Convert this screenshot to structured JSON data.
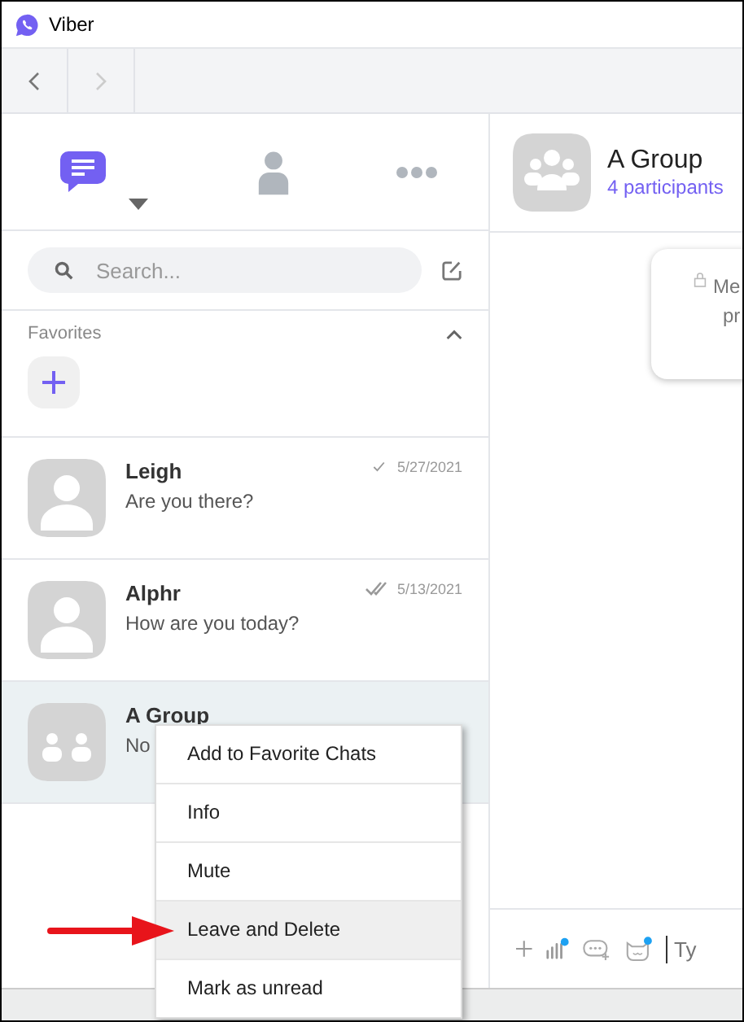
{
  "window": {
    "title": "Viber"
  },
  "tabs": [
    {
      "kind": "chats",
      "selected": true
    },
    {
      "kind": "contacts",
      "selected": false
    },
    {
      "kind": "more",
      "selected": false
    }
  ],
  "search": {
    "placeholder": "Search..."
  },
  "favorites": {
    "label": "Favorites",
    "expanded": true
  },
  "chats": [
    {
      "name": "Leigh",
      "preview": "Are you there?",
      "date": "5/27/2021",
      "read": false,
      "kind": "person",
      "selected": false
    },
    {
      "name": "Alphr",
      "preview": "How are you today?",
      "date": "5/13/2021",
      "read": true,
      "kind": "person",
      "selected": false
    },
    {
      "name": "A Group",
      "preview": "No",
      "kind": "group",
      "selected": true
    }
  ],
  "conversation": {
    "name": "A Group",
    "subtitle": "4 participants",
    "notice_lines": [
      "Me",
      "pr"
    ],
    "input_placeholder": "Ty"
  },
  "context_menu": [
    {
      "label": "Add to Favorite Chats",
      "selected": false
    },
    {
      "label": "Info",
      "selected": false
    },
    {
      "label": "Mute",
      "selected": false
    },
    {
      "label": "Leave and Delete",
      "selected": true
    },
    {
      "label": "Mark as unread",
      "selected": false
    }
  ]
}
